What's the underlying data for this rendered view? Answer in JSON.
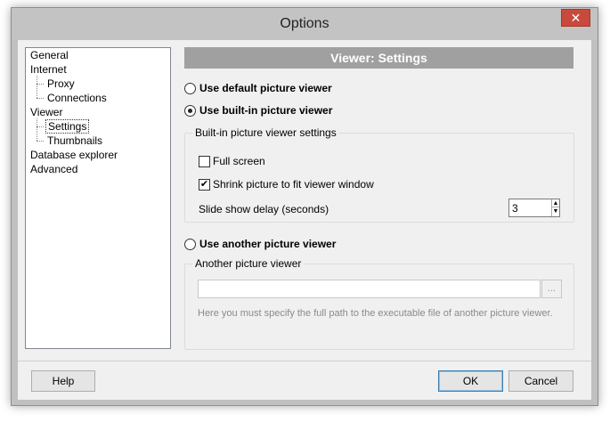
{
  "window": {
    "title": "Options",
    "close_glyph": "✕"
  },
  "tree": {
    "items": [
      {
        "label": "General"
      },
      {
        "label": "Internet"
      },
      {
        "label": "Proxy"
      },
      {
        "label": "Connections"
      },
      {
        "label": "Viewer"
      },
      {
        "label": "Settings",
        "selected": true
      },
      {
        "label": "Thumbnails"
      },
      {
        "label": "Database explorer"
      },
      {
        "label": "Advanced"
      }
    ]
  },
  "panel": {
    "header": "Viewer: Settings",
    "radio_default": "Use default picture viewer",
    "radio_builtin": "Use built-in picture viewer",
    "radio_another": "Use another picture viewer",
    "builtin_group": {
      "title": "Built-in picture viewer settings",
      "full_screen": "Full screen",
      "shrink": "Shrink picture to fit viewer window",
      "slide_label": "Slide show delay (seconds)",
      "slide_value": "3"
    },
    "another_group": {
      "title": "Another picture viewer",
      "path_value": "",
      "browse_label": "...",
      "hint": "Here you must specify the full path to the executable file of another picture viewer."
    }
  },
  "buttons": {
    "help": "Help",
    "ok": "OK",
    "cancel": "Cancel"
  },
  "colors": {
    "header_bg": "#a0a0a0",
    "close_bg": "#c94a3c",
    "default_border": "#3c7fb1"
  }
}
